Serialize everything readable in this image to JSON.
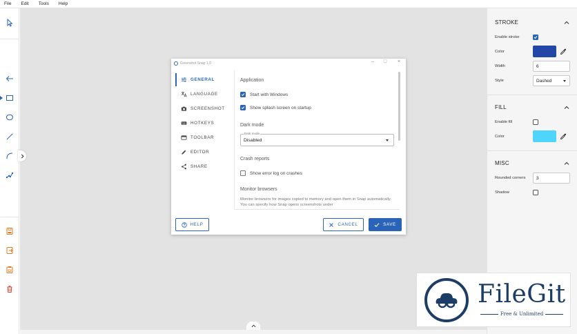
{
  "menubar": {
    "items": [
      "File",
      "Edit",
      "Tools",
      "Help"
    ]
  },
  "dialog": {
    "title": "Greenshot Snap 1.0",
    "nav": [
      {
        "label": "GENERAL",
        "icon": "sliders-icon"
      },
      {
        "label": "LANGUAGE",
        "icon": "translate-icon"
      },
      {
        "label": "SCREENSHOT",
        "icon": "camera-icon"
      },
      {
        "label": "HOTKEYS",
        "icon": "keyboard-icon"
      },
      {
        "label": "TOOLBAR",
        "icon": "toolbar-icon"
      },
      {
        "label": "EDITOR",
        "icon": "pencil-icon"
      },
      {
        "label": "SHARE",
        "icon": "share-icon"
      }
    ],
    "sections": {
      "application": "Application",
      "start_with_windows": "Start with Windows",
      "show_splash": "Show splash screen on startup",
      "dark_mode": "Dark mode",
      "dark_mode_field_label": "Dark mode",
      "dark_mode_value": "Disabled",
      "crash_reports": "Crash reports",
      "show_error_log": "Show error log on crashes",
      "monitor_browsers": "Monitor browsers",
      "monitor_desc": "Monitor browsers for images copied to memory and open them in Snap automatically. You can specify how Snap opens screenshots under"
    },
    "checkboxes": {
      "start_with_windows": true,
      "show_splash": true,
      "show_error_log": false
    },
    "buttons": {
      "help": "HELP",
      "cancel": "CANCEL",
      "save": "SAVE"
    }
  },
  "panel": {
    "stroke": {
      "title": "STROKE",
      "enable_label": "Enable stroke",
      "enabled": true,
      "color_label": "Color",
      "color": "#2347a6",
      "width_label": "Width",
      "width": "6",
      "style_label": "Style",
      "style": "Dashed"
    },
    "fill": {
      "title": "FILL",
      "enable_label": "Enable fill",
      "enabled": false,
      "color_label": "Color",
      "color": "#4fd4fb"
    },
    "misc": {
      "title": "MISC",
      "rounded_label": "Rounded corners",
      "rounded": "3",
      "shadow_label": "Shadow",
      "shadow": false
    }
  },
  "watermark": {
    "name": "FileGit",
    "tagline": "Free & Unlimited"
  },
  "colors": {
    "accent": "#2a64b8",
    "canvas": "#e3e3e3",
    "edit_icon_orange": "#e07a1f",
    "delete_icon_red": "#d9402f"
  }
}
